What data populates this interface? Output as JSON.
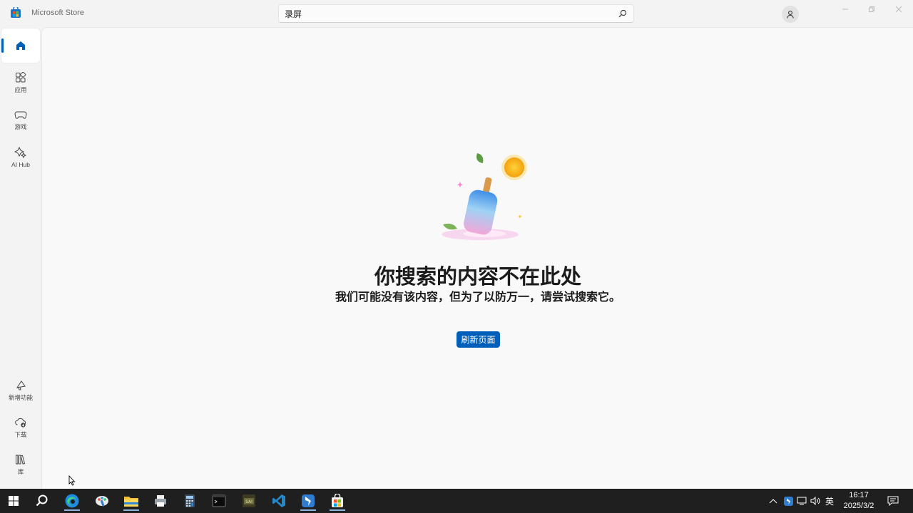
{
  "window": {
    "title": "Microsoft Store",
    "search_value": "录屏"
  },
  "sidebar": {
    "items": [
      {
        "id": "home",
        "label": "",
        "icon": "home-icon",
        "active": true
      },
      {
        "id": "apps",
        "label": "应用",
        "icon": "apps-icon"
      },
      {
        "id": "games",
        "label": "游戏",
        "icon": "gamepad-icon"
      },
      {
        "id": "aihub",
        "label": "AI Hub",
        "icon": "sparkle-icon"
      }
    ],
    "bottom_items": [
      {
        "id": "whatsnew",
        "label": "新增功能",
        "icon": "megaphone-icon"
      },
      {
        "id": "downloads",
        "label": "下载",
        "icon": "cloud-download-icon"
      },
      {
        "id": "library",
        "label": "库",
        "icon": "library-icon"
      }
    ]
  },
  "main": {
    "heading": "你搜索的内容不在此处",
    "subtext": "我们可能没有该内容，但为了以防万一，请尝试搜索它。",
    "refresh_label": "刷新页面"
  },
  "taskbar": {
    "apps": [
      "start-icon",
      "search-icon",
      "edge-icon",
      "paint-icon",
      "file-explorer-icon",
      "printer-icon",
      "calculator-icon",
      "terminal-icon",
      "sai-icon",
      "vscode-icon",
      "feishu-icon",
      "store-icon"
    ],
    "ime_label": "英",
    "time": "16:17",
    "date": "2025/3/2"
  },
  "colors": {
    "accent": "#005fb8",
    "taskbar": "#1f1f1f"
  }
}
